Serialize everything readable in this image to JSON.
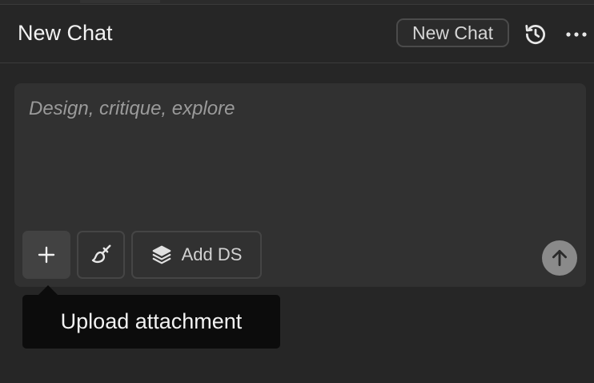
{
  "header": {
    "title": "New Chat",
    "new_chat_label": "New Chat",
    "history_icon": "history-icon",
    "more_icon": "more-horizontal-icon"
  },
  "composer": {
    "placeholder": "Design, critique, explore",
    "upload_icon": "plus-icon",
    "brush_icon": "paintbrush-icon",
    "add_ds_icon": "layers-icon",
    "add_ds_label": "Add DS",
    "send_icon": "arrow-up-icon"
  },
  "tooltip": {
    "text": "Upload attachment"
  },
  "colors": {
    "background": "#262626",
    "composer": "#313131",
    "send_button": "#8a8a8a",
    "tooltip": "#0c0c0c"
  }
}
